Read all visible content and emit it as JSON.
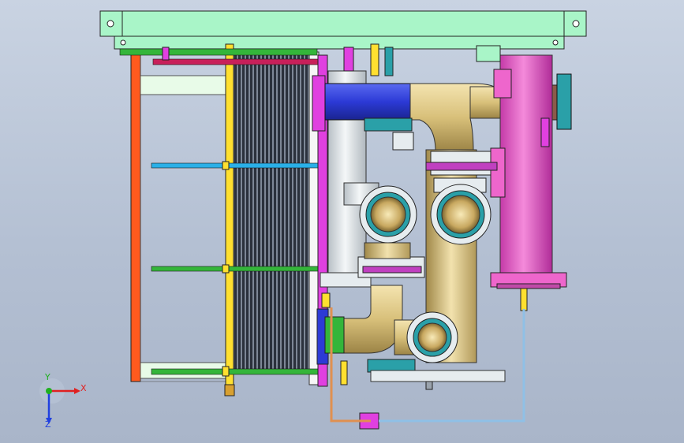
{
  "viewport": {
    "background_top": "#c9d3e2",
    "background_bottom": "#a9b5c9"
  },
  "model": {
    "colors": {
      "frame_top": "#a9f5c8",
      "frame_left": "#ff5a1e",
      "pressure_plate": "#ffe030",
      "plate_pack": "#2e3440",
      "tie_rod_top": "#c8205a",
      "tie_rod_blue": "#2ab0e8",
      "tie_rod_green": "#34b53a",
      "magenta_part": "#e040e0",
      "blue_pipe": "#2c3ad6",
      "brass_pipe": "#d8c07a",
      "white_pipe": "#e6ecef",
      "pink_tank": "#ee66cc",
      "teal_flange": "#2aa0a8",
      "steel": "#9aa3ad"
    }
  },
  "triad": {
    "x_label": "X",
    "y_label": "Y",
    "z_label": "Z",
    "x_color": "#e02020",
    "y_color": "#20b020",
    "z_color": "#2040e0"
  }
}
